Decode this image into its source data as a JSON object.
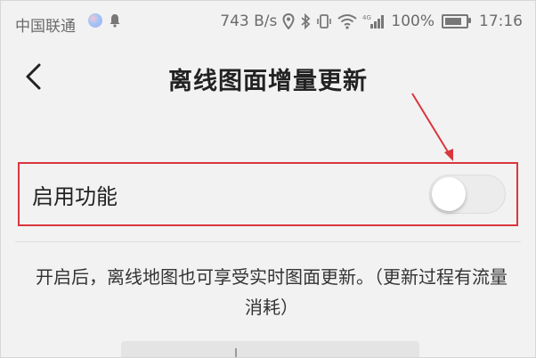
{
  "status_bar": {
    "carrier": "中国联通",
    "net_speed": "743 B/s",
    "network": "4G",
    "battery": "100%",
    "time": "17:16",
    "icons": [
      "app-icon",
      "bell-icon",
      "location-icon",
      "bluetooth-icon",
      "vibrate-icon",
      "wifi-icon",
      "signal-icon",
      "battery-icon"
    ]
  },
  "header": {
    "title": "离线图面增量更新",
    "back_icon": "chevron-left-icon"
  },
  "feature": {
    "label": "启用功能",
    "toggle_on": false
  },
  "description": "开启后，离线地图也可享受实时图面更新。（更新过程有流量消耗）",
  "colors": {
    "annotation_red": "#d9363e",
    "background": "#f2f2f2"
  }
}
